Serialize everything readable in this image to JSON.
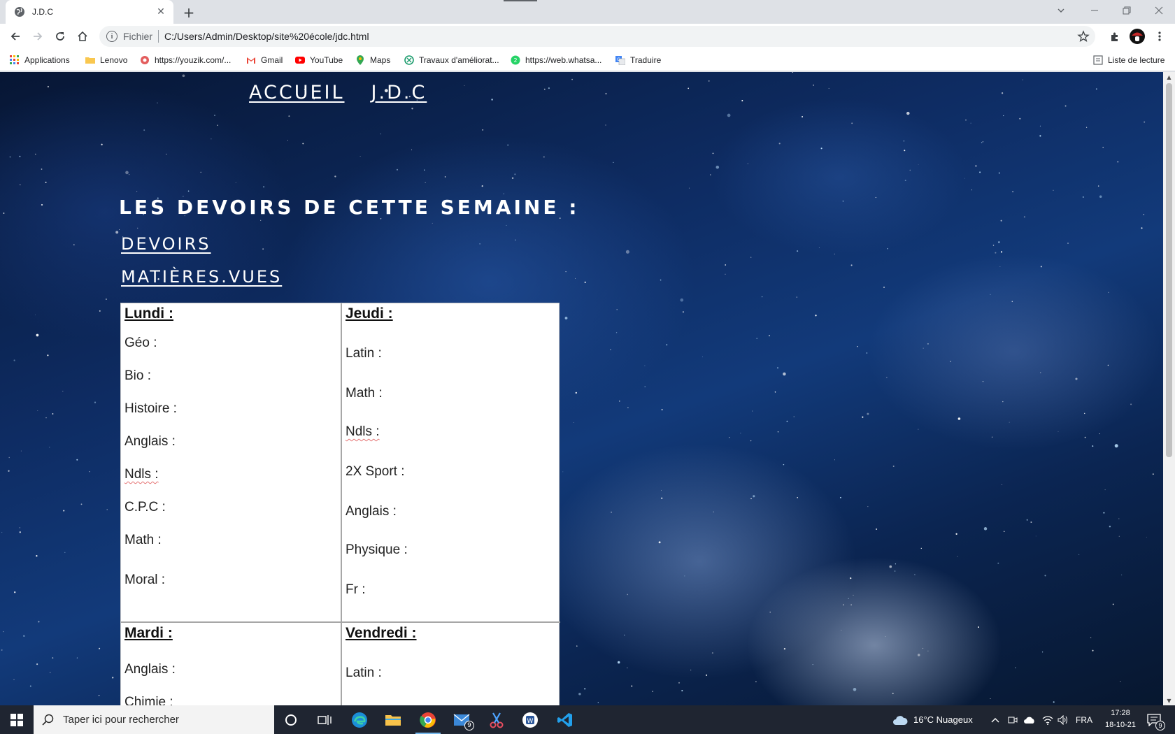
{
  "browser": {
    "tab_title": "J.D.C",
    "new_tab_symbol": "+",
    "omnibox_scheme": "Fichier",
    "omnibox_url": "C:/Users/Admin/Desktop/site%20école/jdc.html"
  },
  "bookmarks": {
    "items": [
      {
        "label": "Applications",
        "icon": "apps-grid-icon"
      },
      {
        "label": "Lenovo",
        "icon": "folder-icon"
      },
      {
        "label": "https://youzik.com/...",
        "icon": "youzik-icon"
      },
      {
        "label": "Gmail",
        "icon": "gmail-icon"
      },
      {
        "label": "YouTube",
        "icon": "youtube-icon"
      },
      {
        "label": "Maps",
        "icon": "maps-pin-icon"
      },
      {
        "label": "Travaux d'améliorat...",
        "icon": "travaux-icon"
      },
      {
        "label": "https://web.whatsa...",
        "icon": "whatsapp-icon"
      },
      {
        "label": "Traduire",
        "icon": "translate-icon"
      }
    ],
    "reading_list": "Liste de lecture"
  },
  "page": {
    "nav": [
      "ACCUEIL",
      "J.D.C"
    ],
    "heading": "LES DEVOIRS DE CETTE SEMAINE :",
    "links": [
      "DEVOIRS",
      "MATIÈRES.VUES"
    ],
    "schedule": {
      "monday": {
        "day": "Lundi :",
        "subjects": [
          "Géo :",
          "Bio :",
          "Histoire :",
          "Anglais :",
          "Ndls :",
          "C.P.C :",
          "Math :",
          "Moral :"
        ]
      },
      "thursday": {
        "day": "Jeudi :",
        "subjects": [
          "Latin :",
          "Math :",
          "Ndls :",
          "2X Sport :",
          "Anglais :",
          "Physique :",
          "Fr :"
        ]
      },
      "tuesday": {
        "day": "Mardi :",
        "subjects": [
          "Anglais :",
          "Chimie :"
        ]
      },
      "friday": {
        "day": "Vendredi :",
        "subjects": [
          "Latin :"
        ]
      }
    }
  },
  "taskbar": {
    "search_placeholder": "Taper ici pour rechercher",
    "weather": "16°C  Nuageux",
    "language": "FRA",
    "time": "17:28",
    "date": "18-10-21",
    "mail_badge": "9",
    "notifications_badge": "9"
  },
  "colors": {
    "page_text": "#ffffff",
    "taskbar": "#1f2531",
    "space_background": "#0e2c63"
  }
}
